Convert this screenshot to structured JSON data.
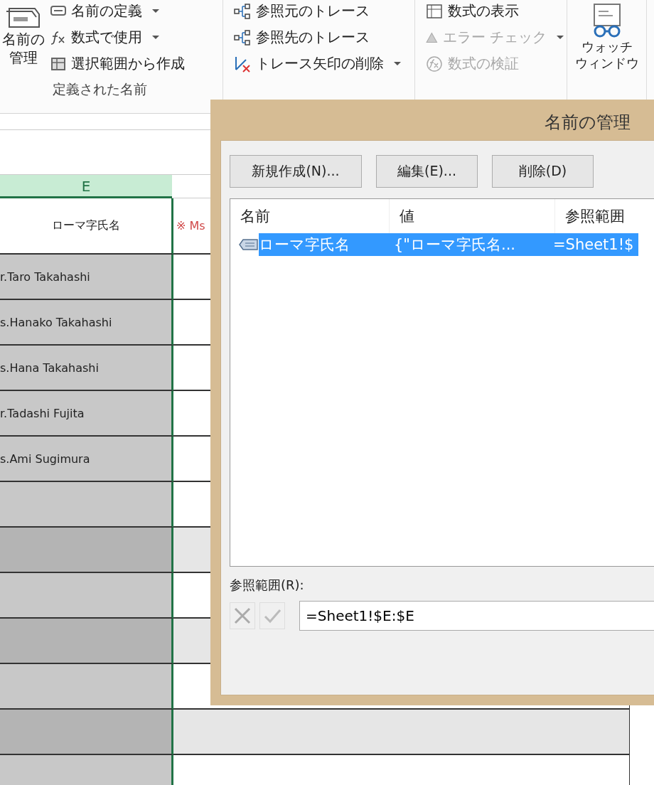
{
  "ribbon": {
    "groups": [
      {
        "kind": "names",
        "large_button": {
          "label": "名前の管理"
        },
        "items": [
          {
            "label": "名前の定義",
            "dropdown": true,
            "disabled": false
          },
          {
            "label": "数式で使用",
            "dropdown": true,
            "disabled": false
          },
          {
            "label": "選択範囲から作成",
            "dropdown": false,
            "disabled": false
          }
        ],
        "group_label": "定義された名前"
      },
      {
        "kind": "list",
        "items": [
          {
            "label": "参照元のトレース",
            "dropdown": false,
            "disabled": false
          },
          {
            "label": "参照先のトレース",
            "dropdown": false,
            "disabled": false
          },
          {
            "label": "トレース矢印の削除",
            "dropdown": true,
            "disabled": false
          }
        ]
      },
      {
        "kind": "list",
        "items": [
          {
            "label": "数式の表示",
            "dropdown": false,
            "disabled": false
          },
          {
            "label": "エラー チェック",
            "dropdown": true,
            "disabled": true
          },
          {
            "label": "数式の検証",
            "dropdown": false,
            "disabled": true
          }
        ]
      },
      {
        "kind": "watch",
        "large_button": {
          "label_lines": [
            "ウォッチ",
            "ウィンドウ"
          ]
        }
      }
    ]
  },
  "sheet": {
    "column_header": "E",
    "rows": [
      {
        "cells": [
          "ローマ字氏名",
          "※ Ms"
        ]
      },
      {
        "cells": [
          "r.Taro Takahashi"
        ]
      },
      {
        "cells": [
          "s.Hanako Takahashi"
        ]
      },
      {
        "cells": [
          "s.Hana Takahashi"
        ]
      },
      {
        "cells": [
          "r.Tadashi Fujita"
        ]
      },
      {
        "cells": [
          "s.Ami Sugimura"
        ]
      }
    ]
  },
  "dialog": {
    "title": "名前の管理",
    "buttons": [
      "新規作成(N)...",
      "編集(E)...",
      "削除(D)"
    ],
    "list": {
      "columns": [
        "名前",
        "値",
        "参照範囲"
      ],
      "rows": [
        {
          "cells": [
            "ローマ字氏名",
            "{\"ローマ字氏名...",
            "=Sheet1!$"
          ],
          "selected": true
        }
      ]
    },
    "refers_to": {
      "label": "参照範囲(R):",
      "value": "=Sheet1!$E:$E"
    }
  }
}
